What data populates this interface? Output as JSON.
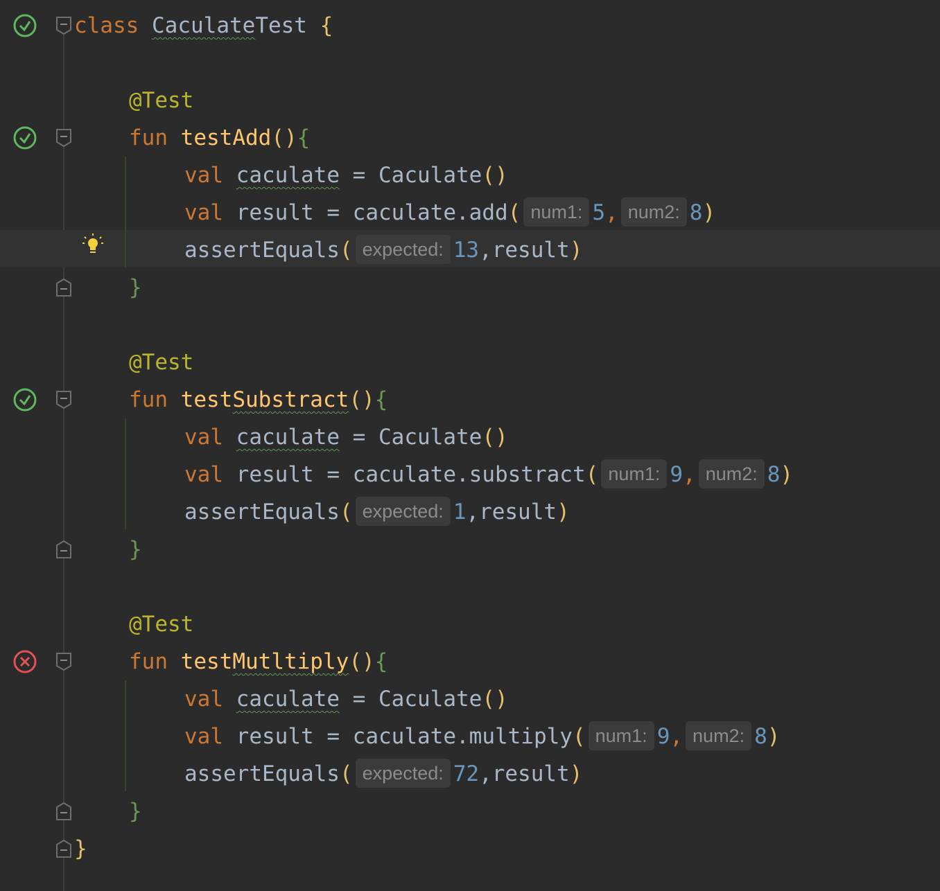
{
  "editor": {
    "colors": {
      "background": "#2b2b2b",
      "keyword": "#cc7832",
      "annotation": "#bbb529",
      "function": "#ffc66d",
      "number": "#6897bb",
      "pass": "#5fb760",
      "fail": "#e35252"
    },
    "class_line": {
      "kw": "class",
      "name_a": "Caculate",
      "name_b": "Test",
      "brace": "{"
    },
    "tests": [
      {
        "annotation": "@Test",
        "status": "passed",
        "fun_kw": "fun",
        "name_a": "test",
        "name_b": "Add",
        "parens": "()",
        "open_brace": "{",
        "line1": {
          "kw": "val",
          "var": "caculate",
          "eq": "=",
          "ctor": "Caculate",
          "parens": "()"
        },
        "line2": {
          "kw": "val",
          "var": "result",
          "eq": "=",
          "call": "caculate.",
          "method": "add",
          "open": "(",
          "hint1": "num1:",
          "arg1": "5",
          "comma": ",",
          "hint2": "num2:",
          "arg2": "8",
          "close": ")"
        },
        "line3": {
          "call": "assertEquals",
          "open": "(",
          "hint": "expected:",
          "value": "13",
          "rest": ",result",
          "close": ")"
        },
        "close_brace": "}"
      },
      {
        "annotation": "@Test",
        "status": "passed",
        "fun_kw": "fun",
        "name_a": "test",
        "name_b": "Substract",
        "parens": "()",
        "open_brace": "{",
        "line1": {
          "kw": "val",
          "var": "caculate",
          "eq": "=",
          "ctor": "Caculate",
          "parens": "()"
        },
        "line2": {
          "kw": "val",
          "var": "result",
          "eq": "=",
          "call": "caculate.",
          "method": "substract",
          "open": "(",
          "hint1": "num1:",
          "arg1": "9",
          "comma": ",",
          "hint2": "num2:",
          "arg2": "8",
          "close": ")"
        },
        "line3": {
          "call": "assertEquals",
          "open": "(",
          "hint": "expected:",
          "value": "1",
          "rest": ",result",
          "close": ")"
        },
        "close_brace": "}"
      },
      {
        "annotation": "@Test",
        "status": "failed",
        "fun_kw": "fun",
        "name_a": "test",
        "name_b": "Mutltiply",
        "parens": "()",
        "open_brace": "{",
        "line1": {
          "kw": "val",
          "var": "caculate",
          "eq": "=",
          "ctor": "Caculate",
          "parens": "()"
        },
        "line2": {
          "kw": "val",
          "var": "result",
          "eq": "=",
          "call": "caculate.",
          "method": "multiply",
          "open": "(",
          "hint1": "num1:",
          "arg1": "9",
          "comma": ",",
          "hint2": "num2:",
          "arg2": "8",
          "close": ")"
        },
        "line3": {
          "call": "assertEquals",
          "open": "(",
          "hint": "expected:",
          "value": "72",
          "rest": ",result",
          "close": ")"
        },
        "close_brace": "}"
      }
    ],
    "class_close": "}",
    "icons": {
      "pass": "check-circle-icon",
      "fail": "x-circle-icon",
      "fold": "fold-marker-icon",
      "intention": "lightbulb-icon"
    }
  }
}
